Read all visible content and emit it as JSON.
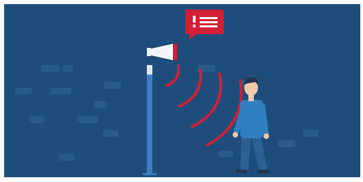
{
  "scene": {
    "description_free": true,
    "colors": {
      "frame": "#ffffff",
      "background": "#1e4d7b",
      "background_mark": "#295a88",
      "pole": "#3b7ec2",
      "pole_light": "#dfe8f3",
      "speaker": "#f2f4f7",
      "accent_red": "#d21f35",
      "person_shirt": "#2f7fc1",
      "person_pants": "#2d5f95",
      "skin": "#f0c9a8",
      "hair": "#23364f"
    },
    "icons": {
      "notification": "alert-message-icon",
      "speaker": "megaphone-icon"
    }
  }
}
